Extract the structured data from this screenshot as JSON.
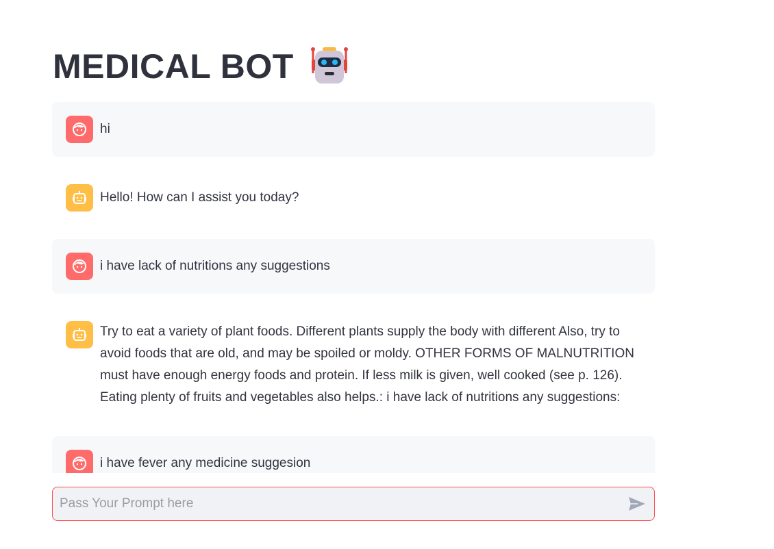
{
  "page": {
    "title": "MEDICAL BOT",
    "title_icon": "robot-icon"
  },
  "messages": [
    {
      "role": "user",
      "avatar_icon": "user-face-icon",
      "text": "hi"
    },
    {
      "role": "assistant",
      "avatar_icon": "bot-face-icon",
      "text": "Hello! How can I assist you today?"
    },
    {
      "role": "user",
      "avatar_icon": "user-face-icon",
      "text": "i have lack of nutritions any suggestions"
    },
    {
      "role": "assistant",
      "avatar_icon": "bot-face-icon",
      "text": "Try to eat a variety of plant foods. Different plants supply the body with different Also, try to avoid foods that are old, and may be spoiled or moldy. OTHER FORMS OF MALNUTRITION must have enough energy foods and protein. If less milk is given, well cooked (see p. 126). Eating plenty of fruits and vegetables also helps.: i have lack of nutritions any suggestions:"
    },
    {
      "role": "user",
      "avatar_icon": "user-face-icon",
      "text": "i have fever any medicine suggesion"
    }
  ],
  "chat_input": {
    "placeholder": "Pass Your Prompt here",
    "value": "",
    "send_icon": "send-icon"
  },
  "colors": {
    "user_avatar": "#ff6b6b",
    "bot_avatar": "#ffbf47",
    "user_bubble": "#f7f8fa",
    "input_border": "#ff4b4b",
    "input_bg": "#f0f2f6",
    "text": "#31333f"
  }
}
